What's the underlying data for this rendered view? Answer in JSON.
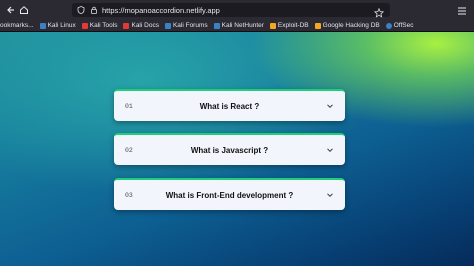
{
  "browser": {
    "url": "https://mopanoaccordion.netlify.app",
    "bookmarks": [
      {
        "label": "ookmarks...",
        "color": "#9aa0a6"
      },
      {
        "label": "Kali Linux",
        "color": "#3b82c4"
      },
      {
        "label": "Kali Tools",
        "color": "#e53935"
      },
      {
        "label": "Kali Docs",
        "color": "#e53935"
      },
      {
        "label": "Kali Forums",
        "color": "#3b82c4"
      },
      {
        "label": "Kali NetHunter",
        "color": "#3b82c4"
      },
      {
        "label": "Exploit-DB",
        "color": "#f5a623"
      },
      {
        "label": "Google Hacking DB",
        "color": "#f5a623"
      },
      {
        "label": "OffSec",
        "color": "#3b82c4"
      }
    ]
  },
  "accordion": [
    {
      "number": "01",
      "question": "What is React ?"
    },
    {
      "number": "02",
      "question": "What is Javascript ?"
    },
    {
      "number": "03",
      "question": "What is Front-End development ?"
    }
  ],
  "colors": {
    "accent": "#1fce7a",
    "card_bg": "#f2f6fc"
  }
}
